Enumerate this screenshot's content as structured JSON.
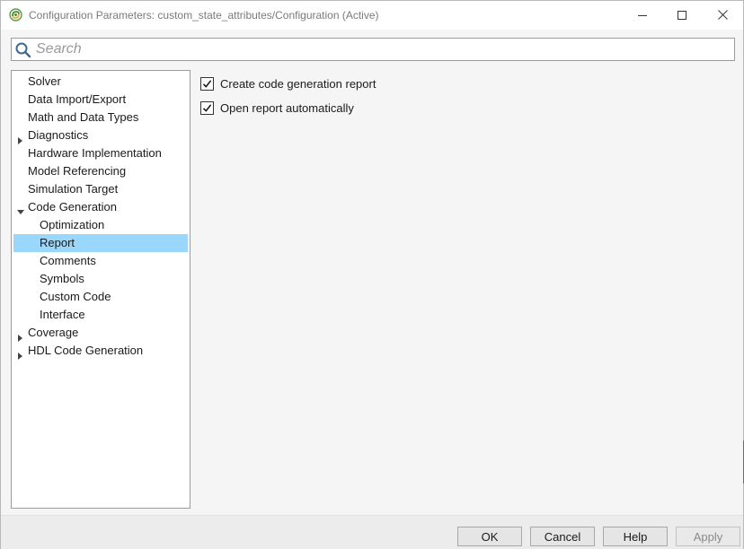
{
  "window": {
    "title": "Configuration Parameters: custom_state_attributes/Configuration (Active)",
    "app_icon": "simulink-icon",
    "controls": [
      "minimize-icon",
      "maximize-icon",
      "close-icon"
    ]
  },
  "search": {
    "placeholder": "Search",
    "value": ""
  },
  "tree": {
    "items": [
      {
        "label": "Solver",
        "expander": "none",
        "level": 0,
        "selected": false
      },
      {
        "label": "Data Import/Export",
        "expander": "none",
        "level": 0,
        "selected": false
      },
      {
        "label": "Math and Data Types",
        "expander": "none",
        "level": 0,
        "selected": false
      },
      {
        "label": "Diagnostics",
        "expander": "collapsed",
        "level": 0,
        "selected": false
      },
      {
        "label": "Hardware Implementation",
        "expander": "none",
        "level": 0,
        "selected": false
      },
      {
        "label": "Model Referencing",
        "expander": "none",
        "level": 0,
        "selected": false
      },
      {
        "label": "Simulation Target",
        "expander": "none",
        "level": 0,
        "selected": false
      },
      {
        "label": "Code Generation",
        "expander": "expanded",
        "level": 0,
        "selected": false
      },
      {
        "label": "Optimization",
        "expander": "none",
        "level": 1,
        "selected": false
      },
      {
        "label": "Report",
        "expander": "none",
        "level": 1,
        "selected": true
      },
      {
        "label": "Comments",
        "expander": "none",
        "level": 1,
        "selected": false
      },
      {
        "label": "Symbols",
        "expander": "none",
        "level": 1,
        "selected": false
      },
      {
        "label": "Custom Code",
        "expander": "none",
        "level": 1,
        "selected": false
      },
      {
        "label": "Interface",
        "expander": "none",
        "level": 1,
        "selected": false
      },
      {
        "label": "Coverage",
        "expander": "collapsed",
        "level": 0,
        "selected": false
      },
      {
        "label": "HDL Code Generation",
        "expander": "collapsed",
        "level": 0,
        "selected": false
      }
    ],
    "selected_color": "#99d7fc"
  },
  "report": {
    "options": [
      {
        "label": "Create code generation report",
        "checked": true
      },
      {
        "label": "Open report automatically",
        "checked": true
      }
    ]
  },
  "buttons": {
    "ok": "OK",
    "cancel": "Cancel",
    "help": "Help",
    "apply": "Apply",
    "apply_enabled": false
  }
}
